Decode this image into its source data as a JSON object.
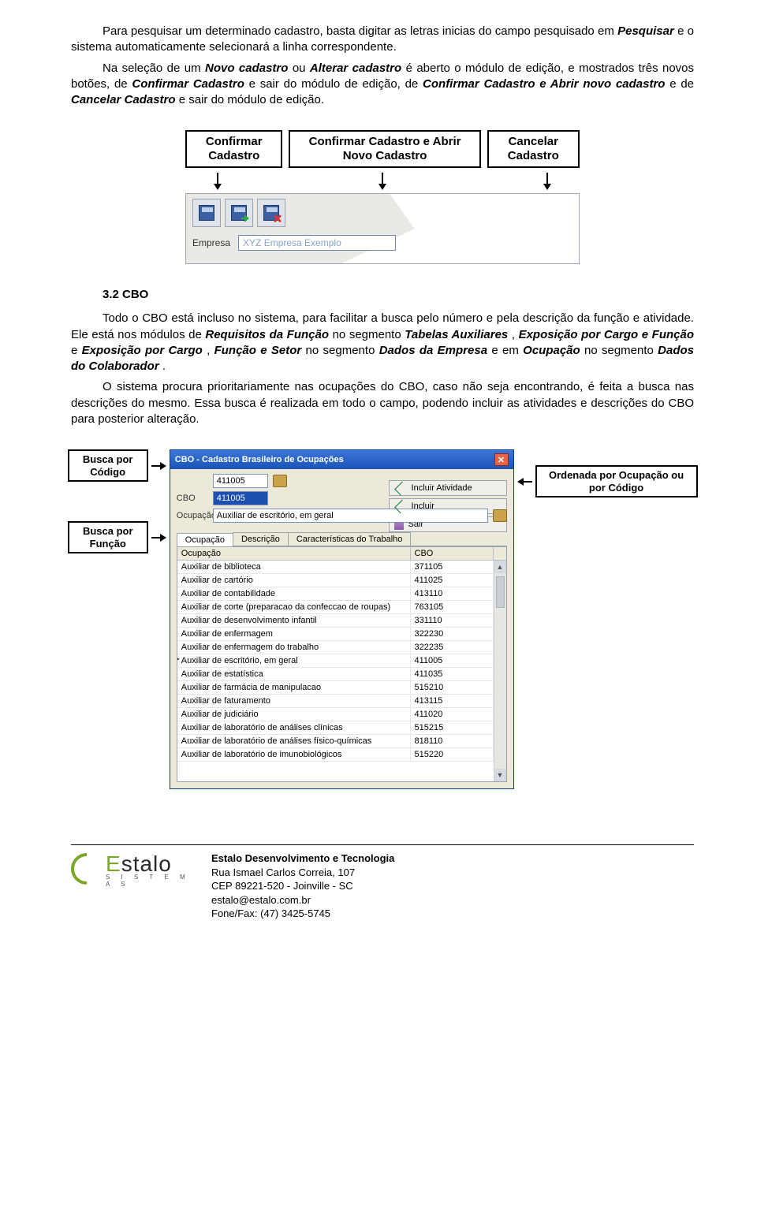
{
  "para1a": "Para pesquisar um determinado cadastro, basta digitar as letras inicias do campo pesquisado em ",
  "para1b": "Pesquisar",
  "para1c": " e o sistema automaticamente selecionará a linha correspondente.",
  "para2a": "Na seleção de um ",
  "para2b": "Novo cadastro",
  "para2c": " ou ",
  "para2d": "Alterar cadastro",
  "para2e": " é aberto o módulo de edição, e mostrados três novos botões, de ",
  "para2f": "Confirmar Cadastro",
  "para2g": " e sair do módulo de edição, de ",
  "para2h": "Confirmar Cadastro e Abrir novo cadastro",
  "para2i": " e de ",
  "para2j": "Cancelar Cadastro",
  "para2k": " e sair do módulo de edição.",
  "fig1": {
    "label1": "Confirmar Cadastro",
    "label2": "Confirmar Cadastro e Abrir Novo Cadastro",
    "label3": "Cancelar Cadastro",
    "fieldLabel": "Empresa",
    "fieldValue": "XYZ Empresa Exemplo"
  },
  "sectionHead": "3.2 CBO",
  "para3": "Todo o CBO está incluso no sistema, para facilitar a busca pelo número e pela descrição da função e atividade. Ele está nos módulos de ",
  "para3b": "Requisitos da Função",
  "para3c": " no segmento ",
  "para3d": "Tabelas Auxiliares",
  "para3e": ", ",
  "para3f": "Exposição por Cargo e Função",
  "para3g": " e ",
  "para3h": "Exposição por Cargo",
  "para3i": ", ",
  "para3j": "Função e Setor",
  "para3k": " no segmento ",
  "para3l": "Dados da Empresa",
  "para3m": " e em ",
  "para3n": "Ocupação",
  "para3o": " no segmento ",
  "para3p": "Dados do Colaborador",
  "para3q": ".",
  "para4": "O sistema procura prioritariamente nas ocupações do CBO, caso não seja encontrando, é feita a busca nas descrições do mesmo. Essa busca é realizada em todo o campo, podendo incluir as atividades e descrições do CBO para posterior alteração.",
  "fig2": {
    "leftLabel1": "Busca por Código",
    "leftLabel2": "Busca por Função",
    "rightLabel": "Ordenada por Ocupação ou por Código",
    "title": "CBO - Cadastro Brasileiro de Ocupações",
    "codeTop": "411005",
    "lblCbo": "CBO",
    "codeSel": "411005",
    "lblOcup": "Ocupação",
    "ocupVal": "Auxiliar de escritório, em geral",
    "btn1": "Incluir Atividade",
    "btn2": "Incluir",
    "btn3": "Sair",
    "tab1": "Ocupação",
    "tab2": "Descrição",
    "tab3": "Características do Trabalho",
    "colA": "Ocupação",
    "colB": "CBO",
    "rows": [
      {
        "o": "Auxiliar de biblioteca",
        "c": "371105"
      },
      {
        "o": "Auxiliar de cartório",
        "c": "411025"
      },
      {
        "o": "Auxiliar de contabilidade",
        "c": "413110"
      },
      {
        "o": "Auxiliar de corte (preparacao da confeccao de roupas)",
        "c": "763105"
      },
      {
        "o": "Auxiliar de desenvolvimento infantil",
        "c": "331110"
      },
      {
        "o": "Auxiliar de enfermagem",
        "c": "322230"
      },
      {
        "o": "Auxiliar de enfermagem do trabalho",
        "c": "322235"
      },
      {
        "o": "Auxiliar de escritório, em geral",
        "c": "411005"
      },
      {
        "o": "Auxiliar de estatística",
        "c": "411035"
      },
      {
        "o": "Auxiliar de farmácia de manipulacao",
        "c": "515210"
      },
      {
        "o": "Auxiliar de faturamento",
        "c": "413115"
      },
      {
        "o": "Auxiliar de judiciário",
        "c": "411020"
      },
      {
        "o": "Auxiliar de laboratório de análises clínicas",
        "c": "515215"
      },
      {
        "o": "Auxiliar de laboratório de análises físico-químicas",
        "c": "818110"
      },
      {
        "o": "Auxiliar de laboratório de imunobiológicos",
        "c": "515220"
      }
    ]
  },
  "footer": {
    "line1": "Estalo Desenvolvimento e Tecnologia",
    "line2": "Rua Ismael Carlos Correia, 107",
    "line3": "CEP 89221-520 - Joinville - SC",
    "line4": "estalo@estalo.com.br",
    "line5": "Fone/Fax: (47) 3425-5745",
    "logoBig": "Estalo",
    "logoSub": "S I S T E M A S"
  }
}
